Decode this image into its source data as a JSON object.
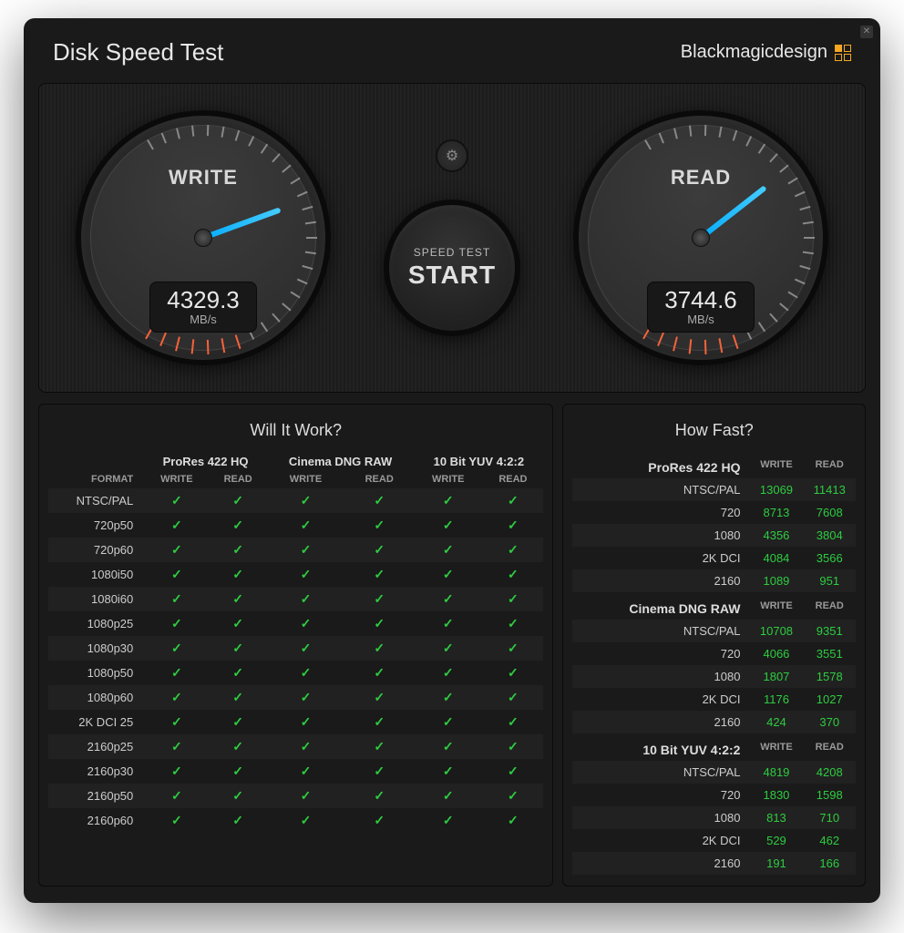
{
  "header": {
    "title": "Disk Speed Test",
    "brand": "Blackmagicdesign"
  },
  "gauges": {
    "write": {
      "label": "WRITE",
      "value": "4329.3",
      "unit": "MB/s",
      "angle": 70
    },
    "read": {
      "label": "READ",
      "value": "3744.6",
      "unit": "MB/s",
      "angle": 52
    }
  },
  "center": {
    "gear_icon": "⚙",
    "small": "SPEED TEST",
    "big": "START"
  },
  "will_it_work": {
    "title": "Will It Work?",
    "format_header": "FORMAT",
    "col_wr": "WRITE",
    "col_rd": "READ",
    "codecs": [
      "ProRes 422 HQ",
      "Cinema DNG RAW",
      "10 Bit YUV 4:2:2"
    ],
    "formats": [
      "NTSC/PAL",
      "720p50",
      "720p60",
      "1080i50",
      "1080i60",
      "1080p25",
      "1080p30",
      "1080p50",
      "1080p60",
      "2K DCI 25",
      "2160p25",
      "2160p30",
      "2160p50",
      "2160p60"
    ]
  },
  "how_fast": {
    "title": "How Fast?",
    "col_wr": "WRITE",
    "col_rd": "READ",
    "sections": [
      {
        "name": "ProRes 422 HQ",
        "rows": [
          {
            "label": "NTSC/PAL",
            "write": "13069",
            "read": "11413"
          },
          {
            "label": "720",
            "write": "8713",
            "read": "7608"
          },
          {
            "label": "1080",
            "write": "4356",
            "read": "3804"
          },
          {
            "label": "2K DCI",
            "write": "4084",
            "read": "3566"
          },
          {
            "label": "2160",
            "write": "1089",
            "read": "951"
          }
        ]
      },
      {
        "name": "Cinema DNG RAW",
        "rows": [
          {
            "label": "NTSC/PAL",
            "write": "10708",
            "read": "9351"
          },
          {
            "label": "720",
            "write": "4066",
            "read": "3551"
          },
          {
            "label": "1080",
            "write": "1807",
            "read": "1578"
          },
          {
            "label": "2K DCI",
            "write": "1176",
            "read": "1027"
          },
          {
            "label": "2160",
            "write": "424",
            "read": "370"
          }
        ]
      },
      {
        "name": "10 Bit YUV 4:2:2",
        "rows": [
          {
            "label": "NTSC/PAL",
            "write": "4819",
            "read": "4208"
          },
          {
            "label": "720",
            "write": "1830",
            "read": "1598"
          },
          {
            "label": "1080",
            "write": "813",
            "read": "710"
          },
          {
            "label": "2K DCI",
            "write": "529",
            "read": "462"
          },
          {
            "label": "2160",
            "write": "191",
            "read": "166"
          }
        ]
      }
    ]
  }
}
